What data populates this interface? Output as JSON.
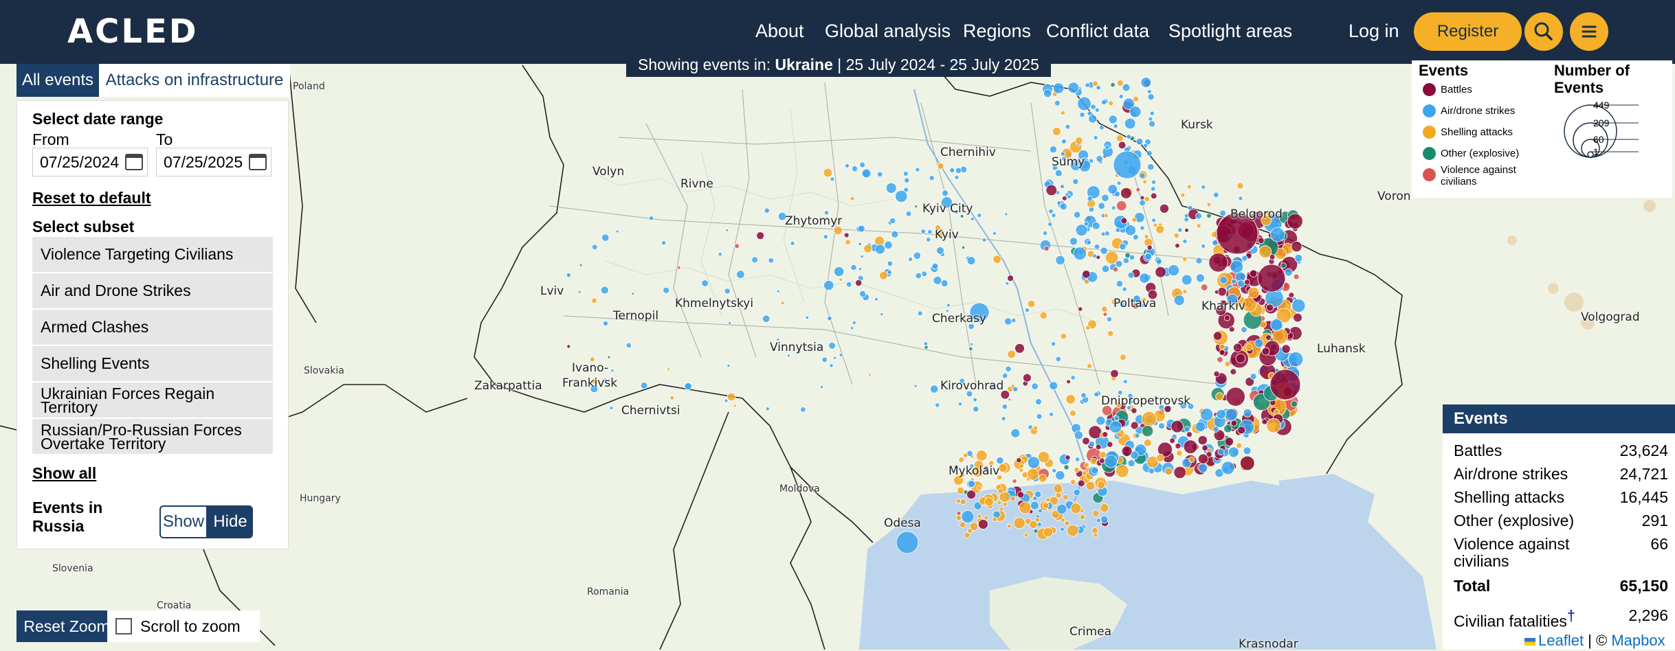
{
  "header": {
    "logo": "ACLED",
    "nav": [
      "About",
      "Global analysis",
      "Regions",
      "Conflict data",
      "Spotlight areas"
    ],
    "login": "Log in",
    "register": "Register",
    "brand_color": "#1b2d44",
    "accent_color": "#f5b027",
    "icons": [
      "search-icon",
      "menu-icon"
    ]
  },
  "banner": {
    "prefix": "Showing events in: ",
    "country": "Ukraine",
    "dates": " | 25 July 2024 - 25 July 2025"
  },
  "tabs": {
    "all": "All events",
    "infrastructure": "Attacks on infrastructure"
  },
  "filters": {
    "date_range_label": "Select date range",
    "from_label": "From",
    "to_label": "To",
    "from_value": "07/25/2024",
    "to_value": "07/25/2025",
    "reset": "Reset to default",
    "subset_label": "Select subset",
    "subsets": [
      "Violence Targeting Civilians",
      "Air and Drone Strikes",
      "Armed Clashes",
      "Shelling Events",
      "Ukrainian Forces Regain Territory",
      "Russian/Pro-Russian Forces Overtake Territory"
    ],
    "show_all": "Show all",
    "russia_label": "Events in Russia",
    "show": "Show",
    "hide": "Hide"
  },
  "map_controls": {
    "reset_zoom": "Reset Zoom",
    "scroll_to_zoom": "Scroll to zoom"
  },
  "legend": {
    "events_title": "Events",
    "items": [
      {
        "label": "Battles",
        "color": "#8b0a3a"
      },
      {
        "label": "Air/drone strikes",
        "color": "#3ba5ee"
      },
      {
        "label": "Shelling attacks",
        "color": "#f5a623"
      },
      {
        "label": "Other (explosive)",
        "color": "#1a8a6e"
      },
      {
        "label": "Violence against civilians",
        "color": "#d9534f"
      }
    ],
    "size_title": "Number of Events",
    "sizes": [
      "449",
      "209",
      "60",
      "1"
    ]
  },
  "events_table": {
    "title": "Events",
    "rows": [
      {
        "label": "Battles",
        "value": "23,624"
      },
      {
        "label": "Air/drone strikes",
        "value": "24,721"
      },
      {
        "label": "Shelling attacks",
        "value": "16,445"
      },
      {
        "label": "Other (explosive)",
        "value": "291"
      },
      {
        "label": "Violence against civilians",
        "value": "66"
      }
    ],
    "total_label": "Total",
    "total_value": "65,150",
    "fatalities_label": "Civilian fatalities",
    "fatalities_mark": "†",
    "fatalities_value": "2,296"
  },
  "attribution": {
    "leaflet": "Leaflet",
    "separator": " | © ",
    "mapbox": "Mapbox"
  },
  "map_labels": {
    "poland": "Poland",
    "kursk": "Kursk",
    "volyn": "Volyn",
    "rivne": "Rivne",
    "chernihiv": "Chernihiv",
    "sumy": "Sumy",
    "belgorod": "Belgorod",
    "voronezh": "Voron",
    "zhytomyr": "Zhytomyr",
    "kyiv_city": "Kyiv City",
    "kyiv": "Kyiv",
    "lviv": "Lviv",
    "ternopil": "Ternopil",
    "khmelnytskyi": "Khmelnytskyi",
    "poltava": "Poltava",
    "kharkiv": "Kharkiv",
    "volgograd": "Volgograd",
    "vinnytsia": "Vinnytsia",
    "cherkasy": "Cherkasy",
    "luhansk": "Luhansk",
    "slovakia": "Slovakia",
    "ivano": "Ivano-",
    "frankivsk": "Frankivsk",
    "zakarpattia": "Zakarpattia",
    "kirovohrad": "Kirovohrad",
    "chernivtsi": "Chernivtsi",
    "dnipropetrovsk": "Dnipropetrovsk",
    "hungary": "Hungary",
    "moldova": "Moldova",
    "mykolaiv": "Mykolaiv",
    "odesa": "Odesa",
    "slovenia": "Slovenia",
    "croatia": "Croatia",
    "romania": "Romania",
    "crimea": "Crimea",
    "krasnodar": "Krasnodar"
  }
}
